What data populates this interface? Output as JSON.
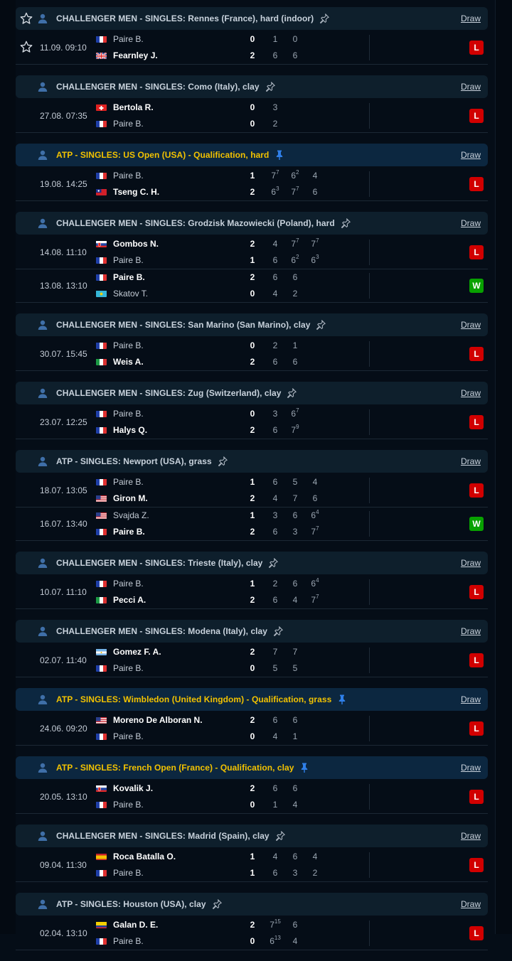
{
  "draw_label": "Draw",
  "results": [
    {
      "title": "CHALLENGER MEN - SINGLES: Rennes (France), hard (indoor)",
      "type": "challenger",
      "header_star": true,
      "matches": [
        {
          "date": "11.09. 09:10",
          "star": true,
          "result": "L",
          "p1": {
            "name": "Paire B.",
            "flag": "fr",
            "winner": false,
            "score": "0",
            "sets": [
              [
                "1",
                ""
              ],
              [
                "0",
                ""
              ],
              [
                "",
                ""
              ]
            ]
          },
          "p2": {
            "name": "Fearnley J.",
            "flag": "gb",
            "winner": true,
            "score": "2",
            "sets": [
              [
                "6",
                ""
              ],
              [
                "6",
                ""
              ],
              [
                "",
                ""
              ]
            ]
          }
        }
      ]
    },
    {
      "title": "CHALLENGER MEN - SINGLES: Como (Italy), clay",
      "type": "challenger",
      "matches": [
        {
          "date": "27.08. 07:35",
          "result": "L",
          "p1": {
            "name": "Bertola R.",
            "flag": "ch",
            "winner": true,
            "score": "0",
            "sets": [
              [
                "3",
                ""
              ],
              [
                "",
                ""
              ],
              [
                "",
                ""
              ]
            ]
          },
          "p2": {
            "name": "Paire B.",
            "flag": "fr",
            "winner": false,
            "score": "0",
            "sets": [
              [
                "2",
                ""
              ],
              [
                "",
                ""
              ],
              [
                "",
                ""
              ]
            ]
          }
        }
      ]
    },
    {
      "title": "ATP - SINGLES: US Open (USA) - Qualification, hard",
      "type": "atp",
      "matches": [
        {
          "date": "19.08. 14:25",
          "result": "L",
          "p1": {
            "name": "Paire B.",
            "flag": "fr",
            "winner": false,
            "score": "1",
            "sets": [
              [
                "7",
                "7"
              ],
              [
                "6",
                "2"
              ],
              [
                "4",
                ""
              ]
            ]
          },
          "p2": {
            "name": "Tseng C. H.",
            "flag": "tw",
            "winner": true,
            "score": "2",
            "sets": [
              [
                "6",
                "3"
              ],
              [
                "7",
                "7"
              ],
              [
                "6",
                ""
              ]
            ]
          }
        }
      ]
    },
    {
      "title": "CHALLENGER MEN - SINGLES: Grodzisk Mazowiecki (Poland), hard",
      "type": "challenger",
      "matches": [
        {
          "date": "14.08. 11:10",
          "result": "L",
          "p1": {
            "name": "Gombos N.",
            "flag": "sk",
            "winner": true,
            "score": "2",
            "sets": [
              [
                "4",
                ""
              ],
              [
                "7",
                "7"
              ],
              [
                "7",
                "7"
              ]
            ]
          },
          "p2": {
            "name": "Paire B.",
            "flag": "fr",
            "winner": false,
            "score": "1",
            "sets": [
              [
                "6",
                ""
              ],
              [
                "6",
                "2"
              ],
              [
                "6",
                "3"
              ]
            ]
          }
        },
        {
          "date": "13.08. 13:10",
          "result": "W",
          "p1": {
            "name": "Paire B.",
            "flag": "fr",
            "winner": true,
            "score": "2",
            "sets": [
              [
                "6",
                ""
              ],
              [
                "6",
                ""
              ],
              [
                "",
                ""
              ]
            ]
          },
          "p2": {
            "name": "Skatov T.",
            "flag": "kz",
            "winner": false,
            "score": "0",
            "sets": [
              [
                "4",
                ""
              ],
              [
                "2",
                ""
              ],
              [
                "",
                ""
              ]
            ]
          }
        }
      ]
    },
    {
      "title": "CHALLENGER MEN - SINGLES: San Marino (San Marino), clay",
      "type": "challenger",
      "matches": [
        {
          "date": "30.07. 15:45",
          "result": "L",
          "p1": {
            "name": "Paire B.",
            "flag": "fr",
            "winner": false,
            "score": "0",
            "sets": [
              [
                "2",
                ""
              ],
              [
                "1",
                ""
              ],
              [
                "",
                ""
              ]
            ]
          },
          "p2": {
            "name": "Weis A.",
            "flag": "it",
            "winner": true,
            "score": "2",
            "sets": [
              [
                "6",
                ""
              ],
              [
                "6",
                ""
              ],
              [
                "",
                ""
              ]
            ]
          }
        }
      ]
    },
    {
      "title": "CHALLENGER MEN - SINGLES: Zug (Switzerland), clay",
      "type": "challenger",
      "matches": [
        {
          "date": "23.07. 12:25",
          "result": "L",
          "p1": {
            "name": "Paire B.",
            "flag": "fr",
            "winner": false,
            "score": "0",
            "sets": [
              [
                "3",
                ""
              ],
              [
                "6",
                "7"
              ],
              [
                "",
                ""
              ]
            ]
          },
          "p2": {
            "name": "Halys Q.",
            "flag": "fr",
            "winner": true,
            "score": "2",
            "sets": [
              [
                "6",
                ""
              ],
              [
                "7",
                "9"
              ],
              [
                "",
                ""
              ]
            ]
          }
        }
      ]
    },
    {
      "title": "ATP - SINGLES: Newport (USA), grass",
      "type": "challenger",
      "matches": [
        {
          "date": "18.07. 13:05",
          "result": "L",
          "p1": {
            "name": "Paire B.",
            "flag": "fr",
            "winner": false,
            "score": "1",
            "sets": [
              [
                "6",
                ""
              ],
              [
                "5",
                ""
              ],
              [
                "4",
                ""
              ]
            ]
          },
          "p2": {
            "name": "Giron M.",
            "flag": "us",
            "winner": true,
            "score": "2",
            "sets": [
              [
                "4",
                ""
              ],
              [
                "7",
                ""
              ],
              [
                "6",
                ""
              ]
            ]
          }
        },
        {
          "date": "16.07. 13:40",
          "result": "W",
          "p1": {
            "name": "Svajda Z.",
            "flag": "us",
            "winner": false,
            "score": "1",
            "sets": [
              [
                "3",
                ""
              ],
              [
                "6",
                ""
              ],
              [
                "6",
                "4"
              ]
            ]
          },
          "p2": {
            "name": "Paire B.",
            "flag": "fr",
            "winner": true,
            "score": "2",
            "sets": [
              [
                "6",
                ""
              ],
              [
                "3",
                ""
              ],
              [
                "7",
                "7"
              ]
            ]
          }
        }
      ]
    },
    {
      "title": "CHALLENGER MEN - SINGLES: Trieste (Italy), clay",
      "type": "challenger",
      "matches": [
        {
          "date": "10.07. 11:10",
          "result": "L",
          "p1": {
            "name": "Paire B.",
            "flag": "fr",
            "winner": false,
            "score": "1",
            "sets": [
              [
                "2",
                ""
              ],
              [
                "6",
                ""
              ],
              [
                "6",
                "4"
              ]
            ]
          },
          "p2": {
            "name": "Pecci A.",
            "flag": "it",
            "winner": true,
            "score": "2",
            "sets": [
              [
                "6",
                ""
              ],
              [
                "4",
                ""
              ],
              [
                "7",
                "7"
              ]
            ]
          }
        }
      ]
    },
    {
      "title": "CHALLENGER MEN - SINGLES: Modena (Italy), clay",
      "type": "challenger",
      "matches": [
        {
          "date": "02.07. 11:40",
          "result": "L",
          "p1": {
            "name": "Gomez F. A.",
            "flag": "ar",
            "winner": true,
            "score": "2",
            "sets": [
              [
                "7",
                ""
              ],
              [
                "7",
                ""
              ],
              [
                "",
                ""
              ]
            ]
          },
          "p2": {
            "name": "Paire B.",
            "flag": "fr",
            "winner": false,
            "score": "0",
            "sets": [
              [
                "5",
                ""
              ],
              [
                "5",
                ""
              ],
              [
                "",
                ""
              ]
            ]
          }
        }
      ]
    },
    {
      "title": "ATP - SINGLES: Wimbledon (United Kingdom) - Qualification, grass",
      "type": "atp",
      "matches": [
        {
          "date": "24.06. 09:20",
          "result": "L",
          "p1": {
            "name": "Moreno De Alboran N.",
            "flag": "us",
            "winner": true,
            "score": "2",
            "sets": [
              [
                "6",
                ""
              ],
              [
                "6",
                ""
              ],
              [
                "",
                ""
              ]
            ]
          },
          "p2": {
            "name": "Paire B.",
            "flag": "fr",
            "winner": false,
            "score": "0",
            "sets": [
              [
                "4",
                ""
              ],
              [
                "1",
                ""
              ],
              [
                "",
                ""
              ]
            ]
          }
        }
      ]
    },
    {
      "title": "ATP - SINGLES: French Open (France) - Qualification, clay",
      "type": "atp",
      "matches": [
        {
          "date": "20.05. 13:10",
          "result": "L",
          "p1": {
            "name": "Kovalik J.",
            "flag": "sk",
            "winner": true,
            "score": "2",
            "sets": [
              [
                "6",
                ""
              ],
              [
                "6",
                ""
              ],
              [
                "",
                ""
              ]
            ]
          },
          "p2": {
            "name": "Paire B.",
            "flag": "fr",
            "winner": false,
            "score": "0",
            "sets": [
              [
                "1",
                ""
              ],
              [
                "4",
                ""
              ],
              [
                "",
                ""
              ]
            ]
          }
        }
      ]
    },
    {
      "title": "CHALLENGER MEN - SINGLES: Madrid (Spain), clay",
      "type": "challenger",
      "matches": [
        {
          "date": "09.04. 11:30",
          "result": "L",
          "p1": {
            "name": "Roca Batalla O.",
            "flag": "es",
            "winner": true,
            "score": "1",
            "sets": [
              [
                "4",
                ""
              ],
              [
                "6",
                ""
              ],
              [
                "4",
                ""
              ]
            ]
          },
          "p2": {
            "name": "Paire B.",
            "flag": "fr",
            "winner": false,
            "score": "1",
            "sets": [
              [
                "6",
                ""
              ],
              [
                "3",
                ""
              ],
              [
                "2",
                ""
              ]
            ]
          }
        }
      ]
    },
    {
      "title": "ATP - SINGLES: Houston (USA), clay",
      "type": "challenger",
      "matches": [
        {
          "date": "02.04. 13:10",
          "result": "L",
          "p1": {
            "name": "Galan D. E.",
            "flag": "co",
            "winner": true,
            "score": "2",
            "sets": [
              [
                "7",
                "15"
              ],
              [
                "6",
                ""
              ],
              [
                "",
                ""
              ]
            ]
          },
          "p2": {
            "name": "Paire B.",
            "flag": "fr",
            "winner": false,
            "score": "0",
            "sets": [
              [
                "6",
                "13"
              ],
              [
                "4",
                ""
              ],
              [
                "",
                ""
              ]
            ]
          }
        }
      ]
    }
  ]
}
